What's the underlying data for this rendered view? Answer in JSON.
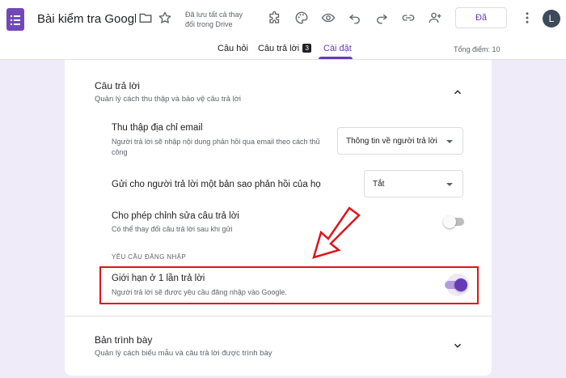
{
  "header": {
    "doc_title": "Bài kiểm tra Google W",
    "saved_status": "Đã lưu tất cả thay đổi trong Drive",
    "send_label": "Đã",
    "avatar_letter": "L",
    "accent_color": "#673ab7"
  },
  "tabs": [
    {
      "label": "Câu hỏi"
    },
    {
      "label": "Câu trả lời",
      "badge": "3"
    },
    {
      "label": "Cài đặt",
      "active": true
    }
  ],
  "total_points": "Tổng điểm: 10",
  "responses_section": {
    "title": "Câu trả lời",
    "subtitle": "Quản lý cách thu thập và bảo vệ câu trả lời",
    "items": [
      {
        "title": "Thu thập địa chỉ email",
        "subtitle": "Người trả lời sẽ nhập nội dung phản hồi qua email theo cách thủ công",
        "select_value": "Thông tin về người trả lời"
      },
      {
        "title": "Gửi cho người trả lời một bản sao phản hồi của họ",
        "select_value": "Tắt"
      },
      {
        "title": "Cho phép chỉnh sửa câu trả lời",
        "subtitle": "Có thể thay đổi câu trả lời sau khi gửi",
        "toggle_on": false
      }
    ],
    "login_group_label": "YÊU CẦU ĐĂNG NHẬP",
    "login_item": {
      "title": "Giới hạn ở 1 lần trả lời",
      "subtitle": "Người trả lời sẽ được yêu cầu đăng nhập vào Google.",
      "toggle_on": true
    }
  },
  "presentation_section": {
    "title": "Bản trình bày",
    "subtitle": "Quản lý cách biểu mẫu và câu trả lời được trình bày"
  },
  "annotation_color": "#e0131c"
}
